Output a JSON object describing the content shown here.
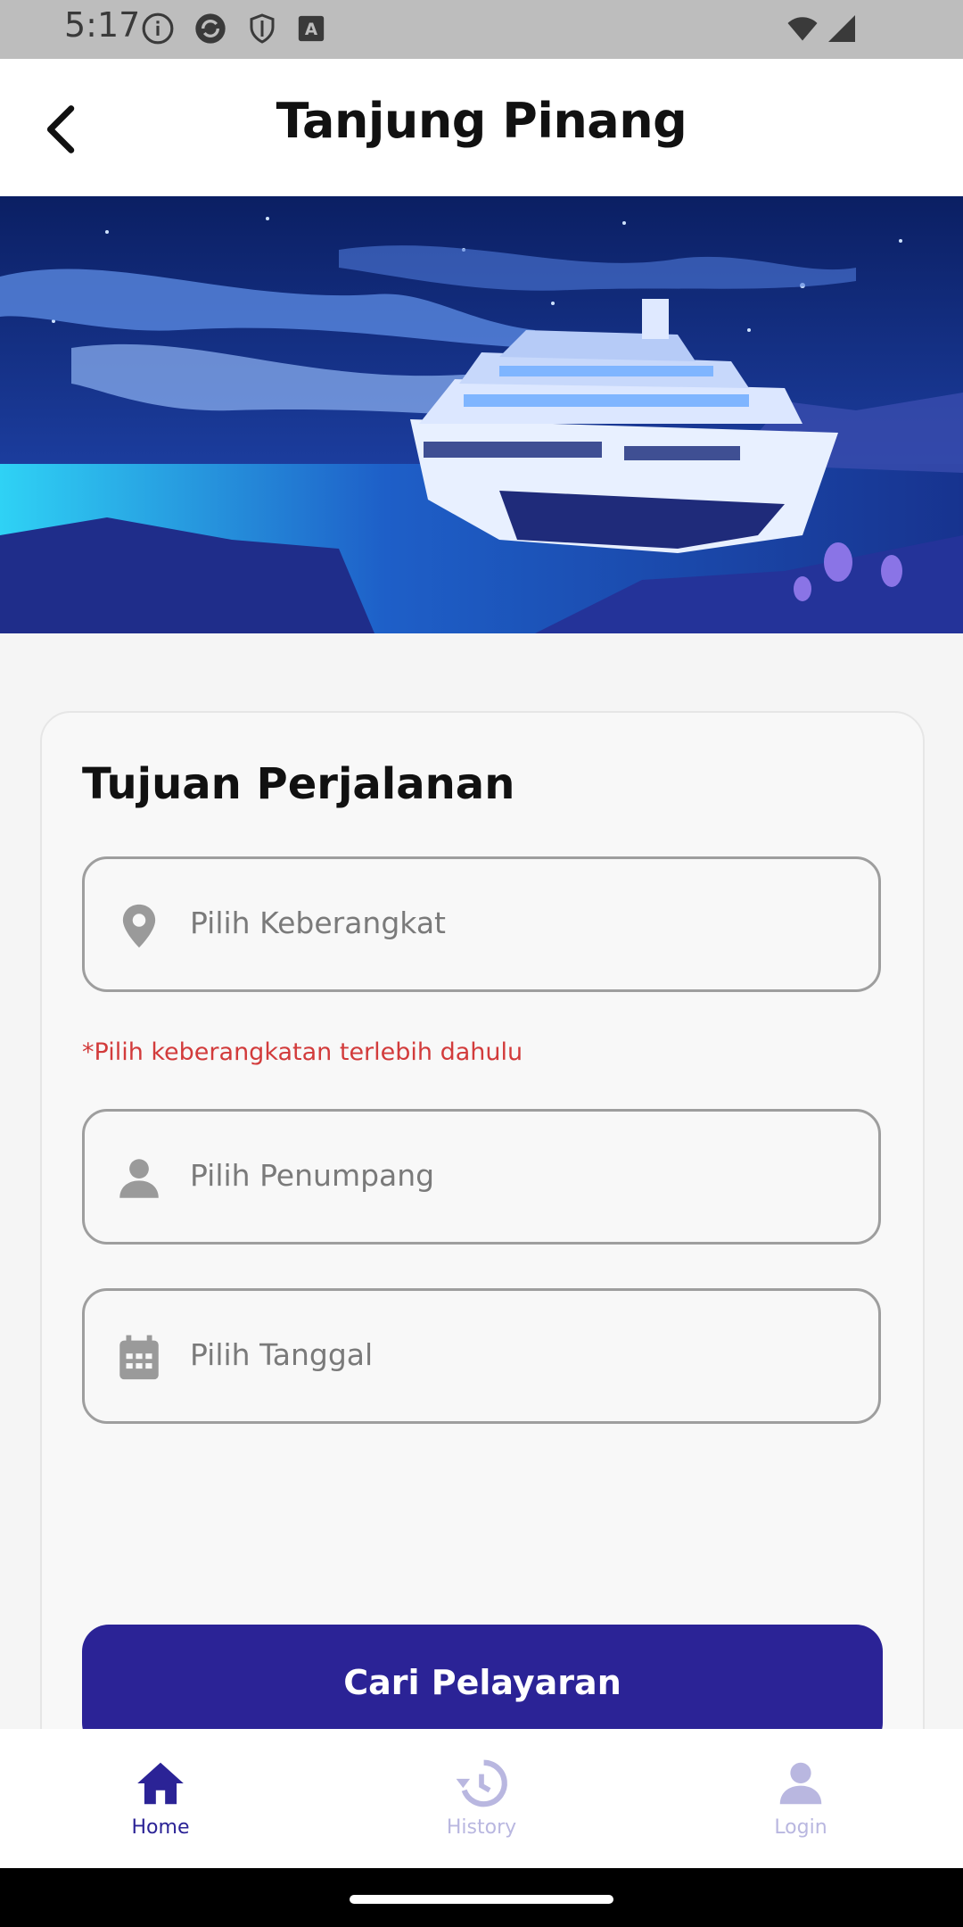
{
  "status_bar": {
    "time": "5:17",
    "left_icons": [
      "info-icon",
      "sync-icon",
      "shield-icon",
      "font-icon"
    ],
    "right_icons": [
      "wifi-icon",
      "signal-icon"
    ]
  },
  "app_bar": {
    "title": "Tanjung Pinang",
    "back_icon": "back-arrow-icon"
  },
  "hero": {
    "description_icon": "cruise-ship-illustration"
  },
  "form": {
    "title": "Tujuan Perjalanan",
    "departure_placeholder": "Pilih Keberangkat",
    "departure_icon": "location-pin-icon",
    "departure_error": "*Pilih keberangkatan terlebih dahulu",
    "passenger_placeholder": "Pilih Penumpang",
    "passenger_icon": "person-icon",
    "date_placeholder": "Pilih Tanggal",
    "date_icon": "calendar-icon",
    "submit_label": "Cari Pelayaran"
  },
  "bottom_nav": {
    "items": [
      {
        "label": "Home",
        "icon": "home-icon",
        "active": true
      },
      {
        "label": "History",
        "icon": "history-icon",
        "active": false
      },
      {
        "label": "Login",
        "icon": "person-icon",
        "active": false
      }
    ]
  },
  "colors": {
    "primary": "#2b2396",
    "error": "#d23b3b",
    "inactive_nav": "#b9b7e0"
  }
}
